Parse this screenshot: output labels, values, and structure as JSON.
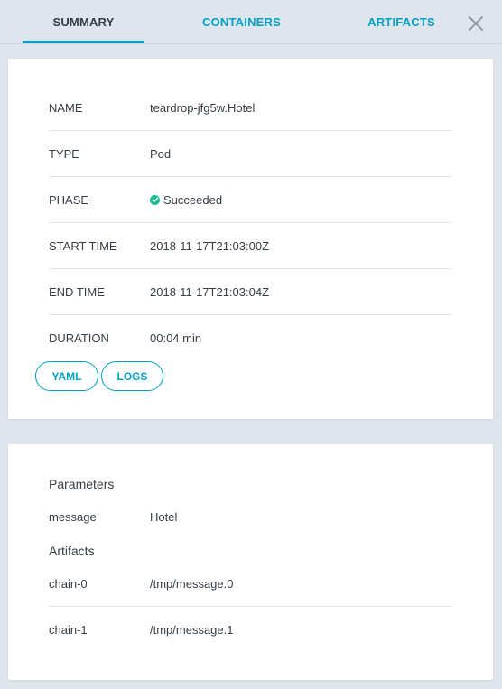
{
  "tabs": {
    "summary": "SUMMARY",
    "containers": "CONTAINERS",
    "artifacts": "ARTIFACTS"
  },
  "summary": {
    "rows": [
      {
        "key": "NAME",
        "value": "teardrop-jfg5w.Hotel"
      },
      {
        "key": "TYPE",
        "value": "Pod"
      },
      {
        "key": "PHASE",
        "value": "Succeeded"
      },
      {
        "key": "START TIME",
        "value": "2018-11-17T21:03:00Z"
      },
      {
        "key": "END TIME",
        "value": "2018-11-17T21:03:04Z"
      },
      {
        "key": "DURATION",
        "value": "00:04 min"
      }
    ],
    "yaml_label": "YAML",
    "logs_label": "LOGS"
  },
  "inputs": {
    "parameters_title": "Parameters",
    "parameters": [
      {
        "key": "message",
        "value": "Hotel"
      }
    ],
    "artifacts_title": "Artifacts",
    "artifacts": [
      {
        "key": "chain-0",
        "value": "/tmp/message.0"
      },
      {
        "key": "chain-1",
        "value": "/tmp/message.1"
      }
    ]
  },
  "colors": {
    "accent": "#00a1c4",
    "success": "#18be94",
    "background": "#dfe5ec"
  },
  "icons": {
    "close": "close-icon",
    "phase_status": "check-circle-icon"
  }
}
